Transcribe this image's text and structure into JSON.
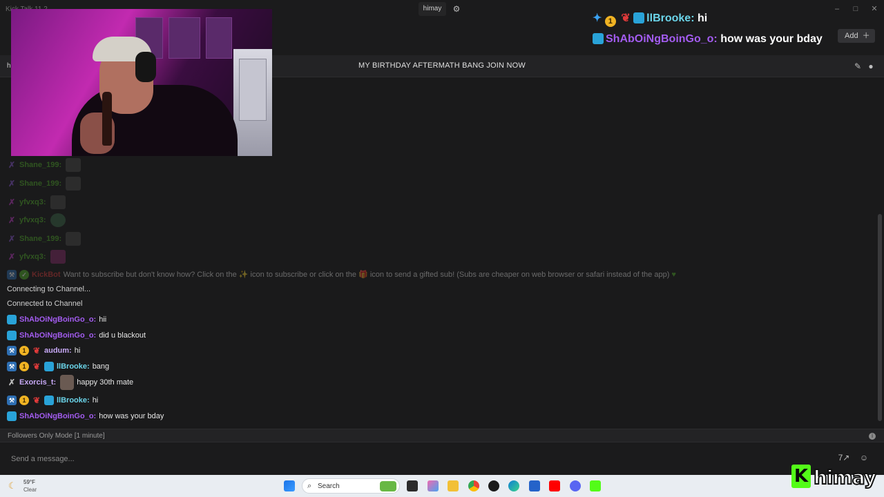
{
  "app": {
    "title": "Kick Talk 11.2"
  },
  "tab": {
    "channel": "himay",
    "settings_icon": "gear-icon"
  },
  "header": {
    "add_label": "Add",
    "add_icon": "plus-icon"
  },
  "overlay_chat": [
    {
      "user": "llBrooke:",
      "message": "hi",
      "user_color": "#6bd5ea"
    },
    {
      "user": "ShAbOiNgBoinGo_o:",
      "message": "how was your bday",
      "user_color": "#a35cf0"
    }
  ],
  "split": {
    "title": "MY BIRTHDAY AFTERMATH BANG JOIN NOW",
    "left_label": "h"
  },
  "chat": {
    "history": [
      {
        "user": "Shane_199:"
      },
      {
        "user": "Shane_199:"
      },
      {
        "user": "yfvxq3:"
      },
      {
        "user": "yfvxq3:"
      },
      {
        "user": "Shane_199:"
      },
      {
        "user": "yfvxq3:"
      }
    ],
    "bot_user": "KickBot",
    "bot_parts": {
      "a": "Want to subscribe but don't know how? Click on the",
      "b": "icon to subscribe or click on the",
      "c": "icon to send a gifted sub! (Subs are cheaper on web browser or safari instead of the app)"
    },
    "connecting": "Connecting to Channel...",
    "connected": "Connected to Channel",
    "messages": [
      {
        "user": "ShAbOiNgBoinGo_o:",
        "text": "hii"
      },
      {
        "user": "ShAbOiNgBoinGo_o:",
        "text": "did u blackout"
      },
      {
        "user": "audum:",
        "text": "hi"
      },
      {
        "user": "llBrooke:",
        "text": "bang"
      },
      {
        "user": "Exorcis_t:",
        "text": "happy 30th mate"
      },
      {
        "user": "llBrooke:",
        "text": "hi"
      },
      {
        "user": "ShAbOiNgBoinGo_o:",
        "text": "how was your bday"
      }
    ]
  },
  "followers_mode": "Followers Only Mode [1 minute]",
  "input": {
    "placeholder": "Send a message..."
  },
  "taskbar": {
    "weather_temp": "59°F",
    "weather_desc": "Clear",
    "search_label": "Search"
  },
  "branding": {
    "kick_letter": "K",
    "channel_name": "himay"
  },
  "colors": {
    "accent_green": "#53fc18",
    "username_green": "#53b32a",
    "username_purple": "#a35cf0",
    "username_teal": "#6bd5ea"
  }
}
